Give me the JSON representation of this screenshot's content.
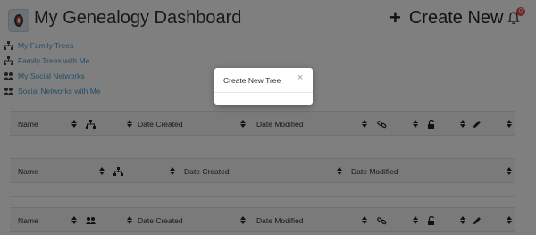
{
  "header": {
    "title": "My Genealogy Dashboard",
    "create_new_label": "Create New",
    "notification_count": "0"
  },
  "nav": {
    "items": [
      {
        "label": "My Family Trees",
        "icon": "sitemap-icon"
      },
      {
        "label": "Family Trees with Me",
        "icon": "sitemap-icon"
      },
      {
        "label": "My Social Networks",
        "icon": "users-icon"
      },
      {
        "label": "Social Networks with Me",
        "icon": "users-icon"
      }
    ]
  },
  "tables": {
    "my_family_trees": {
      "name": "Name",
      "date_created": "Date Created",
      "date_modified": "Date Modified"
    },
    "family_trees_with_me": {
      "name": "Name",
      "date_created": "Date Created",
      "date_modified": "Date Modified"
    },
    "my_social_networks": {
      "name": "Name",
      "date_created": "Date Created",
      "date_modified": "Date Modified"
    }
  },
  "modal": {
    "title": "Create New Tree",
    "close_symbol": "×"
  },
  "colors": {
    "link": "#4a9ad4",
    "overlay": "rgba(0,0,0,0.5)",
    "badge": "#d9534f"
  }
}
